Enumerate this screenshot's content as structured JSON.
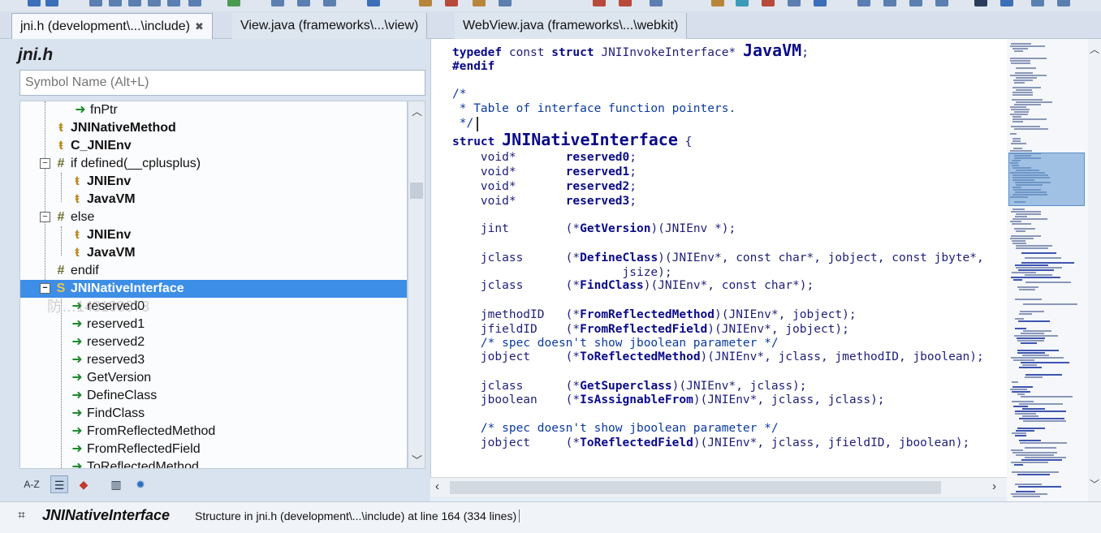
{
  "tabs": [
    {
      "label": "jni.h (development\\...\\include)",
      "close": "✖"
    },
    {
      "label": "View.java (frameworks\\...\\view)"
    },
    {
      "label": "WebView.java (frameworks\\...\\webkit)"
    }
  ],
  "symbols_panel": {
    "file_title": "jni.h",
    "search_placeholder": "Symbol Name (Alt+L)",
    "tree": [
      {
        "label": "fnPtr",
        "icon": "arrow"
      },
      {
        "label": "JNINativeMethod",
        "icon": "typedef",
        "bold": true
      },
      {
        "label": "C_JNIEnv",
        "icon": "typedef",
        "bold": true
      },
      {
        "label": "if defined(__cplusplus)",
        "icon": "preproc"
      },
      {
        "label": "JNIEnv",
        "icon": "typedef",
        "bold": true
      },
      {
        "label": "JavaVM",
        "icon": "typedef",
        "bold": true
      },
      {
        "label": "else",
        "icon": "preproc"
      },
      {
        "label": "JNIEnv",
        "icon": "typedef",
        "bold": true
      },
      {
        "label": "JavaVM",
        "icon": "typedef",
        "bold": true
      },
      {
        "label": "endif",
        "icon": "preproc"
      },
      {
        "label": "JNINativeInterface",
        "icon": "struct",
        "bold": true,
        "selected": true
      },
      {
        "label": "reserved0",
        "icon": "arrow"
      },
      {
        "label": "reserved1",
        "icon": "arrow"
      },
      {
        "label": "reserved2",
        "icon": "arrow"
      },
      {
        "label": "reserved3",
        "icon": "arrow"
      },
      {
        "label": "GetVersion",
        "icon": "arrow"
      },
      {
        "label": "DefineClass",
        "icon": "arrow"
      },
      {
        "label": "FindClass",
        "icon": "arrow"
      },
      {
        "label": "FromReflectedMethod",
        "icon": "arrow"
      },
      {
        "label": "FromReflectedField",
        "icon": "arrow"
      },
      {
        "label": "ToReflectedMethod",
        "icon": "arrow"
      }
    ],
    "watermark": "防…143108873",
    "sort_az_label": "A-Z"
  },
  "code_lines": [
    "typedef const struct JNIInvokeInterface* JavaVM;",
    "#endif",
    "",
    "/*",
    " * Table of interface function pointers.",
    " */",
    "struct JNINativeInterface {",
    "    void*       reserved0;",
    "    void*       reserved1;",
    "    void*       reserved2;",
    "    void*       reserved3;",
    "",
    "    jint        (*GetVersion)(JNIEnv *);",
    "",
    "    jclass      (*DefineClass)(JNIEnv*, const char*, jobject, const jbyte*,",
    "                        jsize);",
    "    jclass      (*FindClass)(JNIEnv*, const char*);",
    "",
    "    jmethodID   (*FromReflectedMethod)(JNIEnv*, jobject);",
    "    jfieldID    (*FromReflectedField)(JNIEnv*, jobject);",
    "    /* spec doesn't show jboolean parameter */",
    "    jobject     (*ToReflectedMethod)(JNIEnv*, jclass, jmethodID, jboolean);",
    "",
    "    jclass      (*GetSuperclass)(JNIEnv*, jclass);",
    "    jboolean    (*IsAssignableFrom)(JNIEnv*, jclass, jclass);",
    "",
    "    /* spec doesn't show jboolean parameter */",
    "    jobject     (*ToReflectedField)(JNIEnv*, jclass, jfieldID, jboolean);"
  ],
  "status": {
    "symbol_name": "JNINativeInterface",
    "description": "Structure in jni.h (development\\...\\include) at line 164 (334 lines)"
  },
  "colors": {
    "selection": "#3c8ee6",
    "keyword": "#0a0a8a",
    "comment": "#0a3aa0"
  }
}
